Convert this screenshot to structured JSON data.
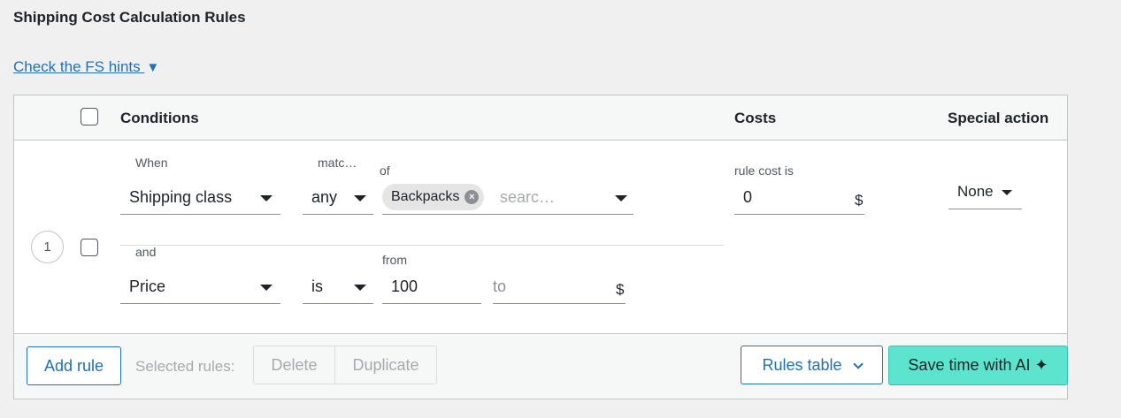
{
  "section_title": "Shipping Cost Calculation Rules",
  "hints_link": {
    "label": "Check the FS hints",
    "arrow": "▼"
  },
  "header": {
    "conditions": "Conditions",
    "costs": "Costs",
    "special_action": "Special action"
  },
  "rule": {
    "number": "1",
    "cond1": {
      "label_when": "When",
      "label_match": "matc…",
      "label_of": "of",
      "type_value": "Shipping class",
      "match_value": "any",
      "chip": "Backpacks",
      "search_placeholder": "searc…"
    },
    "cond2": {
      "label_and": "and",
      "label_from": "from",
      "type_value": "Price",
      "operator_value": "is",
      "from_value": "100",
      "to_placeholder": "to",
      "currency": "$"
    },
    "costs": {
      "label": "rule cost is",
      "value": "0",
      "currency": "$"
    },
    "special_action": "None"
  },
  "footer": {
    "add_rule": "Add rule",
    "selected_rules_label": "Selected rules:",
    "delete": "Delete",
    "duplicate": "Duplicate",
    "rules_table": "Rules table",
    "save_ai": "Save time with AI ✦"
  }
}
